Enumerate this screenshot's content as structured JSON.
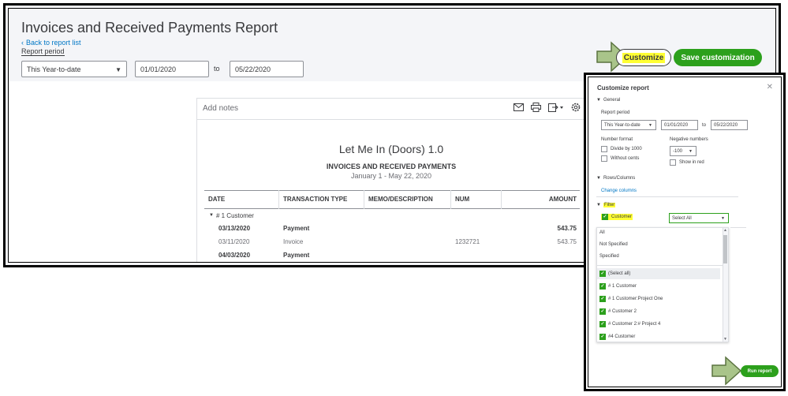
{
  "header": {
    "title": "Invoices and Received Payments Report",
    "back_link": "Back to report list",
    "period_label": "Report period",
    "period_select": "This Year-to-date",
    "date_from": "01/01/2020",
    "to_label": "to",
    "date_to": "05/22/2020",
    "customize_label": "Customize",
    "save_label": "Save customization"
  },
  "report": {
    "add_notes": "Add notes",
    "company": "Let Me In (Doors) 1.0",
    "name": "INVOICES AND RECEIVED PAYMENTS",
    "dates": "January 1 - May 22, 2020",
    "columns": [
      "DATE",
      "TRANSACTION TYPE",
      "MEMO/DESCRIPTION",
      "NUM",
      "AMOUNT"
    ],
    "group": "# 1 Customer",
    "rows": [
      {
        "date": "03/13/2020",
        "type": "Payment",
        "memo": "",
        "num": "",
        "amount": "543.75",
        "bold": true
      },
      {
        "date": "03/11/2020",
        "type": "Invoice",
        "memo": "",
        "num": "1232721",
        "amount": "543.75",
        "bold": false
      },
      {
        "date": "04/03/2020",
        "type": "Payment",
        "memo": "",
        "num": "",
        "amount": "",
        "bold": true
      }
    ]
  },
  "panel": {
    "title": "Customize report",
    "general": "General",
    "report_period": "Report period",
    "period_select": "This Year-to-date",
    "date_from": "01/01/2020",
    "to_label": "to",
    "date_to": "05/22/2020",
    "number_format": "Number format",
    "divide_1000": "Divide by 1000",
    "without_cents": "Without cents",
    "negative_numbers": "Negative numbers",
    "negative_select": "-100",
    "show_in_red": "Show in red",
    "rows_columns": "Rows/Columns",
    "change_columns": "Change columns",
    "filter": "Filter",
    "customer": "Customer",
    "customer_select": "Select All",
    "dropdown_options": [
      "All",
      "Not Specified",
      "Specified"
    ],
    "dropdown_items": [
      "(Select all)",
      "# 1 Customer",
      "# 1 Customer:Project One",
      "# Customer 2",
      "# Customer 2:# Project 4",
      "#4 Customer"
    ],
    "run_report": "Run report"
  },
  "colors": {
    "accent_green": "#2ca01c",
    "highlight": "#ffff33",
    "arrow_fill": "#a9c48a",
    "link_blue": "#0077c5"
  }
}
